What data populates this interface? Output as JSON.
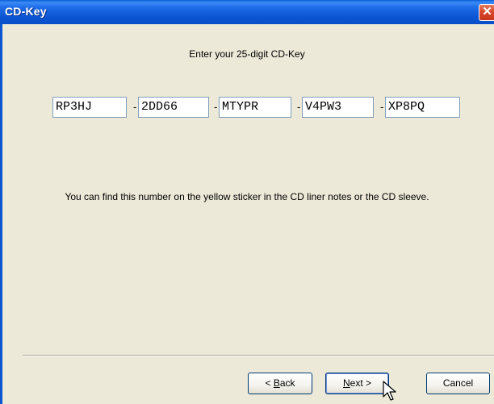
{
  "window": {
    "title": "CD-Key",
    "close_glyph": "✕"
  },
  "main": {
    "prompt": "Enter your 25-digit CD-Key",
    "key_segments": [
      "RP3HJ",
      "2DD66",
      "MTYPR",
      "V4PW3",
      "XP8PQ"
    ],
    "separator": "-",
    "info": "You can find this number on the yellow sticker in the CD liner notes or the CD sleeve."
  },
  "buttons": {
    "back": {
      "prefix": "< ",
      "mnemonic": "B",
      "rest": "ack"
    },
    "next": {
      "mnemonic": "N",
      "rest": "ext >"
    },
    "cancel": "Cancel"
  },
  "icons": {
    "close": "close-icon",
    "cursor": "arrow-cursor-icon"
  },
  "colors": {
    "title_bar": "#0b55d3",
    "dialog_bg": "#ece9d8",
    "close_button": "#d9452a",
    "field_border": "#7f9db9",
    "button_border": "#003c74"
  }
}
